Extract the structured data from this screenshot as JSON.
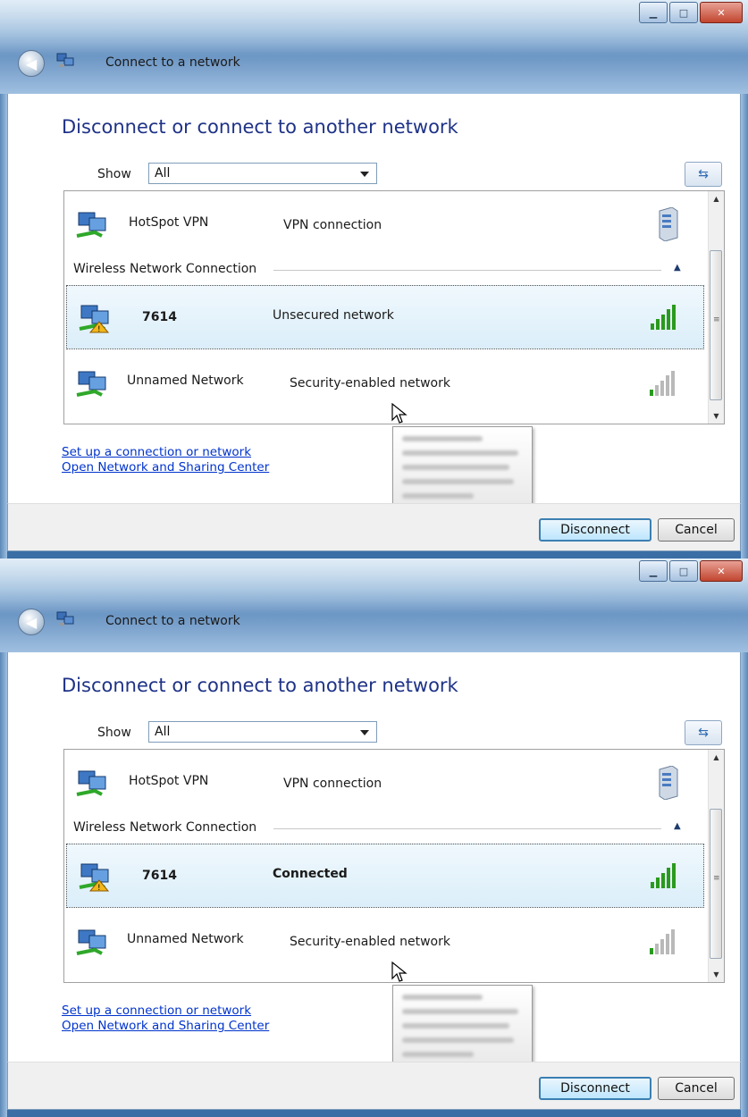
{
  "windows": [
    {
      "title": "Connect to a network",
      "heading": "Disconnect or connect to another network",
      "show_label": "Show",
      "show_value": "All",
      "vpn": {
        "name": "HotSpot VPN",
        "type": "VPN connection"
      },
      "group_label": "Wireless Network Connection",
      "selected": {
        "name": "7614",
        "status": "Unsecured network"
      },
      "unnamed": {
        "name": "Unnamed Network",
        "type": "Security-enabled network"
      },
      "links": [
        "Set up a connection or network",
        "Open Network and Sharing Center"
      ],
      "buttons": {
        "disconnect": "Disconnect",
        "cancel": "Cancel"
      }
    },
    {
      "title": "Connect to a network",
      "heading": "Disconnect or connect to another network",
      "show_label": "Show",
      "show_value": "All",
      "vpn": {
        "name": "HotSpot VPN",
        "type": "VPN connection"
      },
      "group_label": "Wireless Network Connection",
      "selected": {
        "name": "7614",
        "status": "Connected"
      },
      "unnamed": {
        "name": "Unnamed Network",
        "type": "Security-enabled network"
      },
      "links": [
        "Set up a connection or network",
        "Open Network and Sharing Center"
      ],
      "buttons": {
        "disconnect": "Disconnect",
        "cancel": "Cancel"
      }
    }
  ],
  "colors": {
    "heading": "#1e3287",
    "link": "#0033cc",
    "signal_green": "#2a9a1f"
  },
  "icons": [
    "back-arrow-icon",
    "network-icon",
    "minimize-icon",
    "maximize-icon",
    "close-icon",
    "refresh-icon",
    "server-icon",
    "signal-bars-icon",
    "cursor-icon"
  ]
}
